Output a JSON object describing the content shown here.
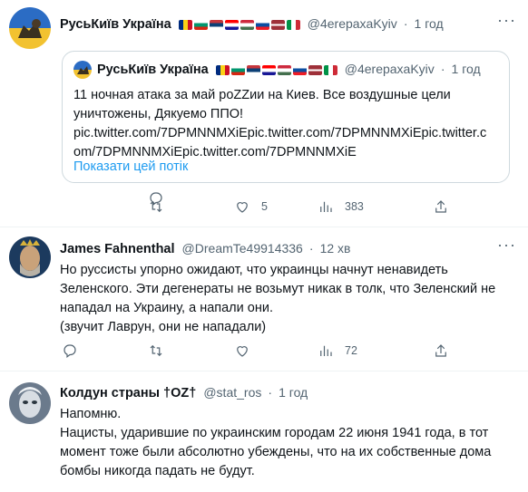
{
  "tweets": [
    {
      "author": "РусьКиїв Україна",
      "handle": "@4erepaxaKyiv",
      "separator": "·",
      "time": "1 год",
      "quote": {
        "author": "РусьКиїв Україна",
        "handle": "@4erepaxaKyiv",
        "separator": "·",
        "time": "1 год",
        "text_lines": [
          "11 ночная атака за май роZZии на Киев. Все воздушные цели",
          "уничтожены, Дякуемо ППО!",
          "pic.twitter.com/7DPMNNMXiEpic.twitter.com/7DPMNNMXiEpic.twitter.c",
          "om/7DPMNNMXiEpic.twitter.com/7DPMNNMXiE"
        ],
        "thread_link": "Показати цей потік"
      },
      "actions": {
        "reply": "",
        "retweet": "",
        "like": "5",
        "views": "383"
      }
    },
    {
      "author": "James Fahnenthal",
      "handle": "@DreamTe49914336",
      "separator": "·",
      "time": "12 хв",
      "text_lines": [
        "Но руссисты упорно ожидают, что украинцы начнут ненавидеть",
        "Зеленского. Эти дегенераты не возьмут никак в толк, что Зеленский не",
        "нападал на Украину, а напали они.",
        "(звучит Лаврун, они не нападали)"
      ],
      "actions": {
        "reply": "",
        "retweet": "",
        "like": "",
        "views": "72"
      }
    },
    {
      "author": "Колдун страны †OZ†",
      "handle": "@stat_ros",
      "separator": "·",
      "time": "1 год",
      "text_lines": [
        "Напомню.",
        "Нацисты, ударившие по украинским городам 22 июня 1941 года, в тот",
        "момент тоже были абсолютно убеждены, что на их собственные дома",
        "бомбы никогда падать не будут."
      ]
    }
  ],
  "more_glyph": "···",
  "colors": {
    "link": "#1d9bf0",
    "muted": "#536471",
    "border": "#cfd9de"
  }
}
